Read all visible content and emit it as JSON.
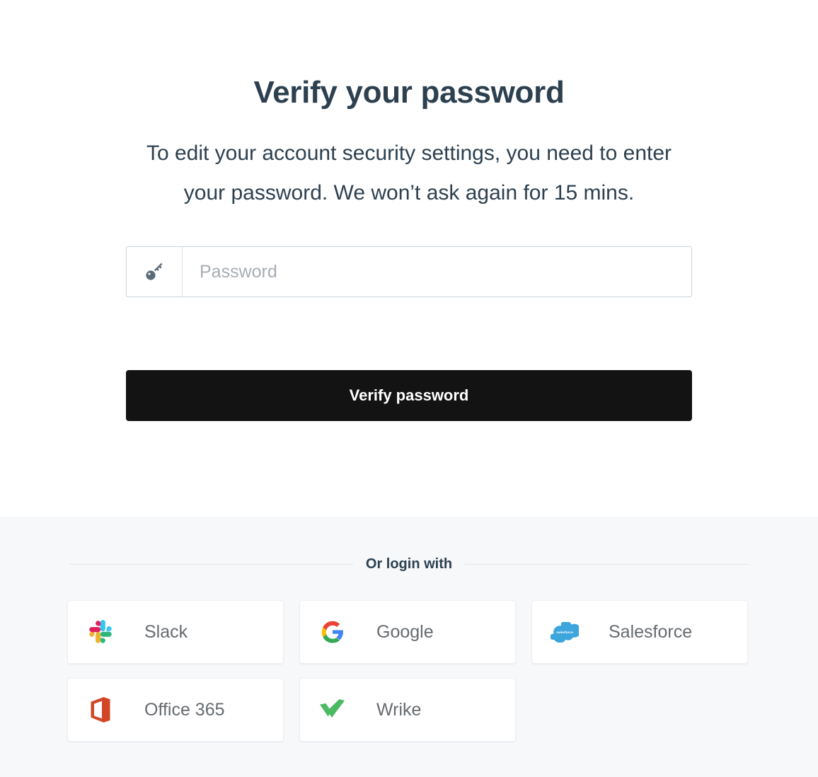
{
  "page": {
    "title": "Verify your password",
    "subtitle": "To edit your account security settings, you need to enter your password. We won’t ask again for 15 mins."
  },
  "form": {
    "password_icon": "key-icon",
    "password_placeholder": "Password",
    "password_value": "",
    "submit_label": "Verify password"
  },
  "sso": {
    "divider_label": "Or login with",
    "providers": [
      {
        "label": "Slack",
        "icon": "slack-icon"
      },
      {
        "label": "Google",
        "icon": "google-icon"
      },
      {
        "label": "Salesforce",
        "icon": "salesforce-icon",
        "wordmark": "salesforce"
      },
      {
        "label": "Office 365",
        "icon": "office365-icon"
      },
      {
        "label": "Wrike",
        "icon": "wrike-icon"
      }
    ]
  },
  "colors": {
    "heading": "#2d4050",
    "button_bg": "#131313",
    "section_bg": "#f6f8fa",
    "input_border": "#c9d4dd",
    "key_icon": "#5c6b7a",
    "slack_blue": "#36c5f0",
    "slack_green": "#2eb67d",
    "slack_yellow": "#ecb22e",
    "slack_red": "#e01e5a",
    "google_blue": "#4285f4",
    "google_red": "#ea4335",
    "google_yellow": "#fbbc05",
    "google_green": "#34a853",
    "salesforce_blue": "#3da5dc",
    "office_red": "#d24726",
    "wrike_green": "#4cb963"
  }
}
